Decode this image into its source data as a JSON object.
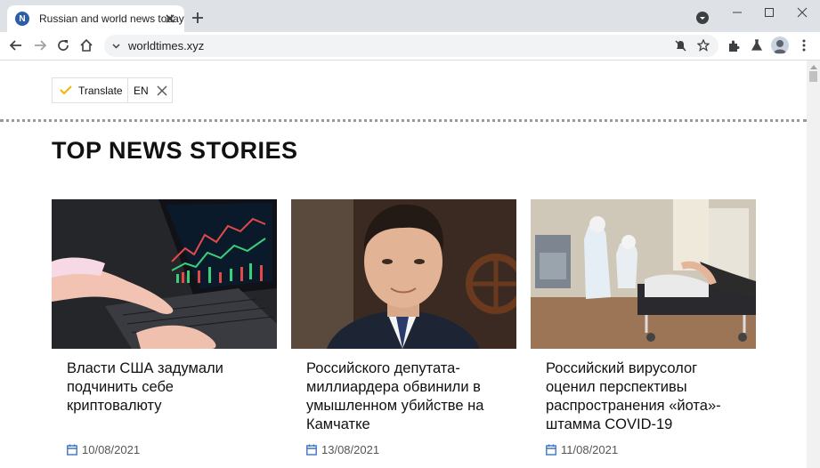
{
  "browser": {
    "tab": {
      "favicon_letter": "N",
      "title": "Russian and world news today"
    },
    "url": "worldtimes.xyz"
  },
  "translate_widget": {
    "label": "Translate",
    "language": "EN"
  },
  "section": {
    "title": "TOP NEWS STORIES"
  },
  "articles": [
    {
      "headline": "Власти США задумали подчинить себе криптовалюту",
      "date": "10/08/2021",
      "image": "laptop-crypto-chart"
    },
    {
      "headline": "Российского депутата-миллиардера обвинили в умышленном убийстве на Камчатке",
      "date": "13/08/2021",
      "image": "man-portrait"
    },
    {
      "headline": "Российский вирусолог оценил перспективы распространения «йота»-штамма COVID-19",
      "date": "11/08/2021",
      "image": "hospital-ward"
    }
  ],
  "colors": {
    "accent_check": "#f5b400",
    "calendar_icon": "#3b73c8",
    "tabstrip": "#dee1e6"
  }
}
